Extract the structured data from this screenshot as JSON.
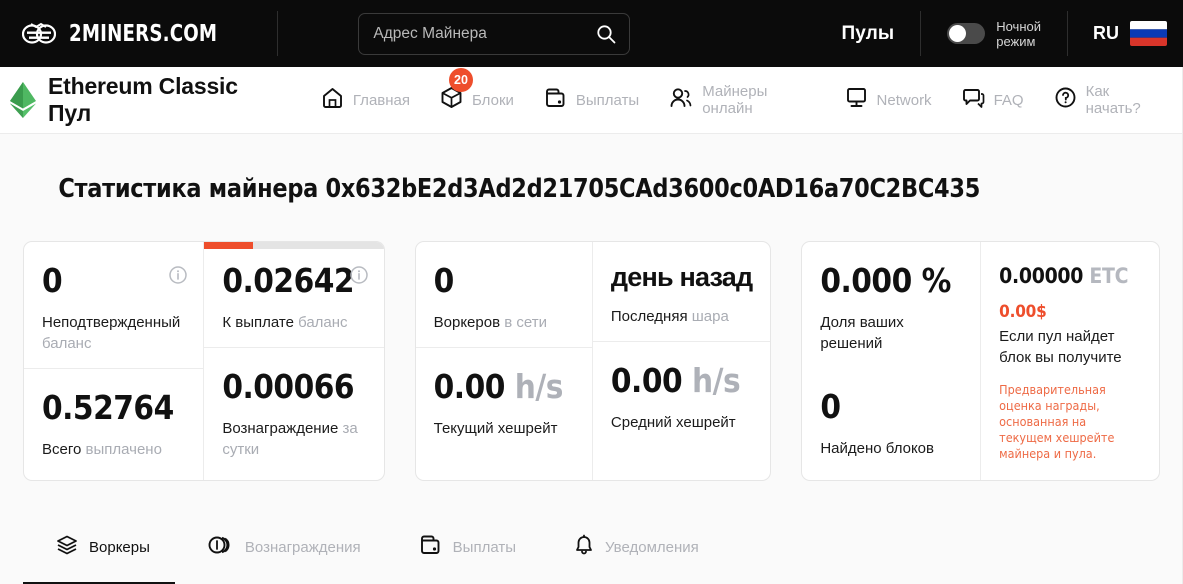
{
  "topbar": {
    "brand_name": "2MINERS.COM",
    "brand_logo_icon": "miner-goggles-icon",
    "search": {
      "placeholder": "Адрес Майнера",
      "value": "",
      "icon": "search-icon"
    },
    "pools_label": "Пулы",
    "night_mode": {
      "label_line1": "Ночной",
      "label_line2": "режим",
      "enabled": false
    },
    "language": {
      "code": "RU",
      "flag": "ru-flag-icon"
    },
    "background_color": "#0b0b0b"
  },
  "nav": {
    "coin_title": "Ethereum Classic Пул",
    "coin_logo_icon": "ethereum-classic-diamond-icon",
    "coin_logo_color": "#3faa52",
    "items": [
      {
        "label": "Главная",
        "icon": "home-icon",
        "badge": null
      },
      {
        "label": "Блоки",
        "icon": "cube-icon",
        "badge": "20"
      },
      {
        "label": "Выплаты",
        "icon": "wallet-icon",
        "badge": null
      },
      {
        "label": "Майнеры онлайн",
        "icon": "users-icon",
        "badge": null
      },
      {
        "label": "Network",
        "icon": "monitor-icon",
        "badge": null
      },
      {
        "label": "FAQ",
        "icon": "chat-icon",
        "badge": null
      },
      {
        "label": "Как начать?",
        "icon": "question-circle-icon",
        "badge": null
      }
    ],
    "badge_color": "#ee4e2c"
  },
  "main": {
    "page_title": "Статистика майнера 0x632bE2d3Ad2d21705CAd3600c0AD16a70C2BC435",
    "accent_color": "#ee4e2c",
    "cards": {
      "balance": {
        "unconfirmed": {
          "value": "0",
          "caption_strong": "Неподтвержденный",
          "caption_muted": "баланс",
          "info_icon": "info-circle-icon"
        },
        "payout": {
          "value": "0.02642",
          "caption_strong": "К выплате",
          "caption_muted": "баланс",
          "info_icon": "info-circle-icon",
          "progress_percent": 27
        },
        "total_paid": {
          "value": "0.52764",
          "caption_strong": "Всего",
          "caption_muted": "выплачено"
        },
        "reward_24h": {
          "value": "0.00066",
          "caption_strong": "Вознаграждение",
          "caption_muted": "за сутки"
        }
      },
      "workers": {
        "online": {
          "value": "0",
          "caption_strong": "Воркеров",
          "caption_muted": "в сети"
        },
        "last_share": {
          "value": "день назад",
          "caption_strong": "Последняя",
          "caption_muted": "шара"
        },
        "current_hashrate": {
          "value": "0.00",
          "unit": "h/s",
          "caption_strong": "Текущий хешрейт",
          "caption_muted": ""
        },
        "average_hashrate": {
          "value": "0.00",
          "unit": "h/s",
          "caption_strong": "Средний хешрейт",
          "caption_muted": ""
        }
      },
      "shares": {
        "round_share": {
          "value": "0.000 %",
          "caption_strong": "Доля ваших",
          "caption_muted": "решений"
        },
        "blocks_found": {
          "value": "0",
          "caption_strong": "Найдено блоков",
          "caption_muted": ""
        },
        "estimate": {
          "amount": "0.00000",
          "unit": "ETC",
          "usd": "0.00$",
          "desc_line1": "Если пул найдет",
          "desc_line2": "блок вы получите",
          "note": "Предварительная оценка награды, основанная на текущем хешрейте майнера и пула.",
          "note_color": "#ee6a45"
        }
      }
    }
  },
  "tabs": [
    {
      "label": "Воркеры",
      "icon": "layers-icon",
      "active": true
    },
    {
      "label": "Вознаграждения",
      "icon": "coins-icon",
      "active": false
    },
    {
      "label": "Выплаты",
      "icon": "wallet-icon",
      "active": false
    },
    {
      "label": "Уведомления",
      "icon": "bell-icon",
      "active": false
    }
  ]
}
